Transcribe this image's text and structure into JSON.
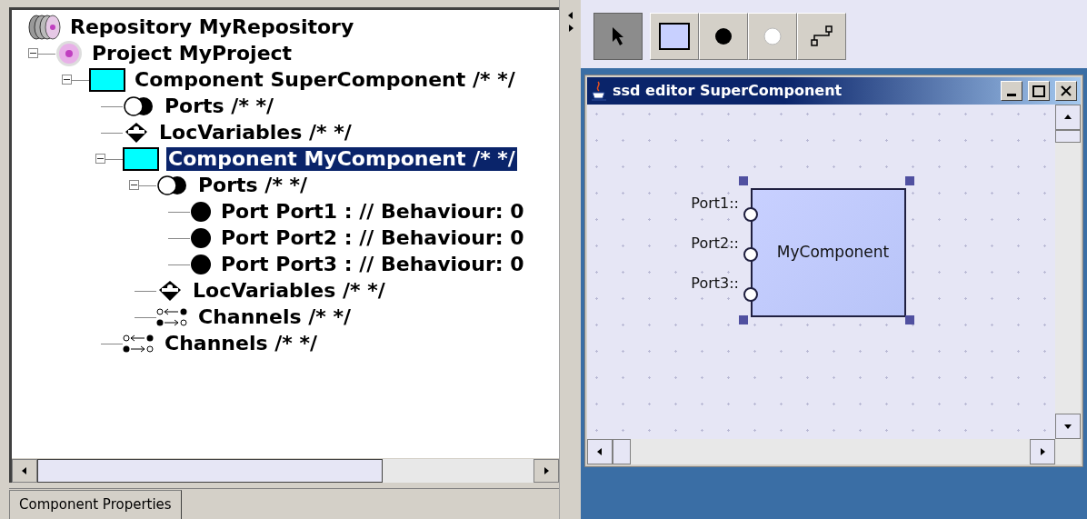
{
  "tree": [
    {
      "kind": "repository",
      "label": "Repository MyRepository",
      "selected": false,
      "children": [
        {
          "kind": "project",
          "label": "Project MyProject",
          "selected": false,
          "expanded": true,
          "children": [
            {
              "kind": "component",
              "label": "Component SuperComponent /* */",
              "selected": false,
              "expanded": true,
              "children": [
                {
                  "kind": "ports",
                  "label": "Ports /* */",
                  "selected": false
                },
                {
                  "kind": "locvariables",
                  "label": "LocVariables /* */",
                  "selected": false
                },
                {
                  "kind": "component",
                  "label": "Component MyComponent /* */",
                  "selected": true,
                  "expanded": true,
                  "children": [
                    {
                      "kind": "ports",
                      "label": "Ports /* */",
                      "selected": false,
                      "expanded": true,
                      "children": [
                        {
                          "kind": "port",
                          "label": "Port Port1 : // Behaviour: 0",
                          "selected": false
                        },
                        {
                          "kind": "port",
                          "label": "Port Port2 : // Behaviour: 0",
                          "selected": false
                        },
                        {
                          "kind": "port",
                          "label": "Port Port3 : // Behaviour: 0",
                          "selected": false
                        }
                      ]
                    },
                    {
                      "kind": "locvariables",
                      "label": "LocVariables /* */",
                      "selected": false
                    },
                    {
                      "kind": "channels",
                      "label": "Channels /* */",
                      "selected": false
                    }
                  ]
                },
                {
                  "kind": "channels",
                  "label": "Channels /* */",
                  "selected": false
                }
              ]
            }
          ]
        }
      ]
    }
  ],
  "tabs": [
    {
      "label": "Component Properties",
      "selected": true
    }
  ],
  "toolbar": [
    {
      "kind": "pointer",
      "selected": true
    },
    {
      "kind": "component",
      "selected": false
    },
    {
      "kind": "input-port",
      "selected": false
    },
    {
      "kind": "output-port",
      "selected": false
    },
    {
      "kind": "channel",
      "selected": false
    }
  ],
  "editor": {
    "title": "ssd editor SuperComponent",
    "component": {
      "name": "MyComponent",
      "selected": true,
      "ports": [
        {
          "label": "Port1::"
        },
        {
          "label": "Port2::"
        },
        {
          "label": "Port3::"
        }
      ]
    }
  }
}
